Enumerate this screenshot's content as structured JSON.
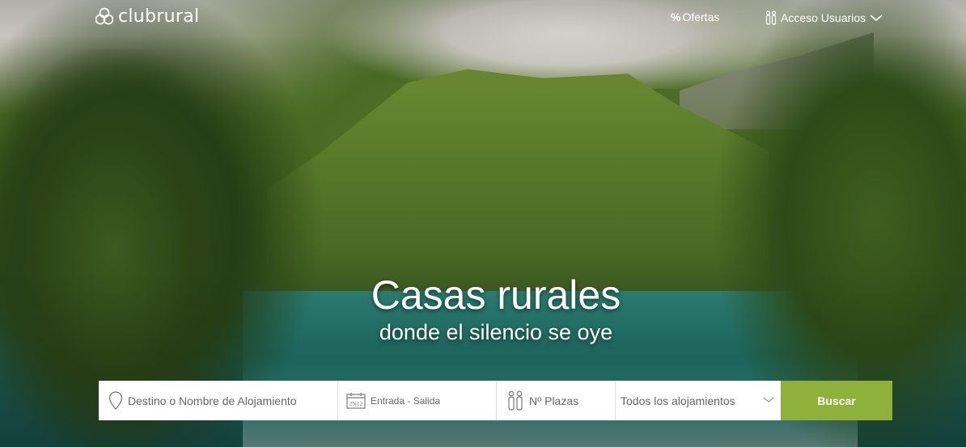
{
  "header": {
    "logo_text": "clubrural",
    "nav": {
      "offers_label": "Ofertas",
      "offers_icon": "%",
      "access_label": "Acceso Usuarios"
    }
  },
  "hero": {
    "title": "Casas rurales",
    "subtitle": "donde el silencio se oye"
  },
  "search": {
    "destination_placeholder": "Destino o Nombre de Alojamiento",
    "dates_placeholder": "Entrada - Salida",
    "calendar_icon_text": "25|12",
    "places_placeholder": "Nº Plazas",
    "type_selected": "Todos los alojamientos",
    "button_label": "Buscar"
  },
  "colors": {
    "button": "#8db13b",
    "search_bg": "#ffffff",
    "text_white": "#ffffff"
  },
  "icons": [
    "logo-icon",
    "percent-icon",
    "users-icon",
    "chevron-down-icon",
    "location-pin-icon",
    "calendar-icon",
    "people-icon"
  ]
}
